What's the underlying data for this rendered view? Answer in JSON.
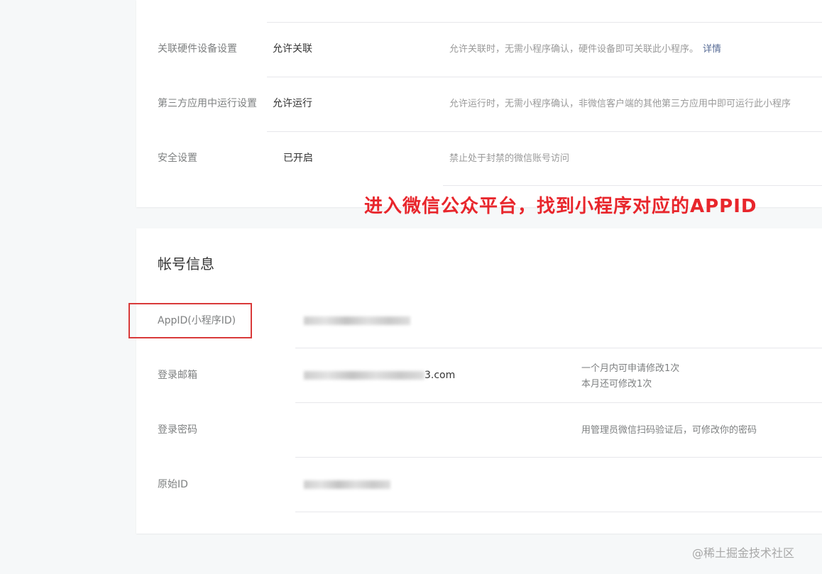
{
  "settings": [
    {
      "label": "关联硬件设备设置",
      "value": "允许关联",
      "desc": "允许关联时，无需小程序确认，硬件设备即可关联此小程序。",
      "link": "详情"
    },
    {
      "label": "第三方应用中运行设置",
      "value": "允许运行",
      "desc": "允许运行时，无需小程序确认，非微信客户端的其他第三方应用中即可运行此小程序",
      "link": ""
    },
    {
      "label": "安全设置",
      "value": "已开启",
      "desc": "禁止处于封禁的微信账号访问",
      "link": ""
    }
  ],
  "annotation": "进入微信公众平台，找到小程序对应的APPID",
  "account": {
    "title": "帐号信息",
    "rows": [
      {
        "label": "AppID(小程序ID)",
        "value_suffix": "",
        "desc1": "",
        "desc2": ""
      },
      {
        "label": "登录邮箱",
        "value_suffix": "3.com",
        "desc1": "一个月内可申请修改1次",
        "desc2": "本月还可修改1次"
      },
      {
        "label": "登录密码",
        "value_suffix": "",
        "desc1": "用管理员微信扫码验证后，可修改你的密码",
        "desc2": ""
      },
      {
        "label": "原始ID",
        "value_suffix": "",
        "desc1": "",
        "desc2": ""
      }
    ]
  },
  "watermark": "@稀土掘金技术社区",
  "colors": {
    "accent_red": "#e8262c",
    "link_blue": "#576b95"
  }
}
